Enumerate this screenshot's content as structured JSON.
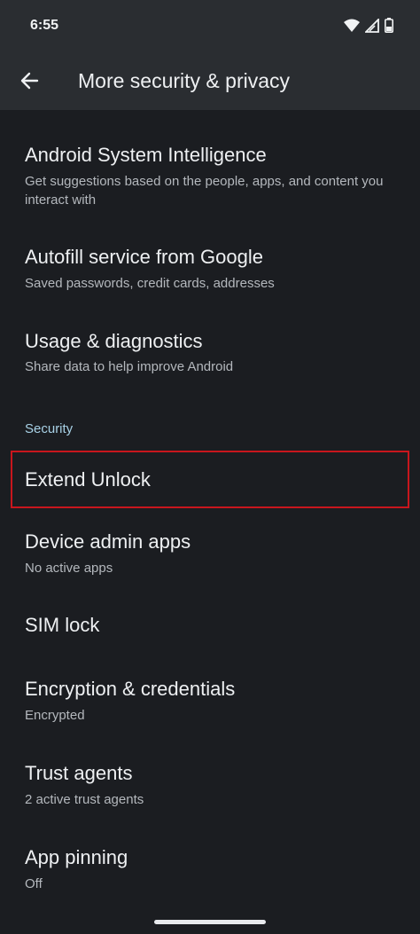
{
  "status_bar": {
    "time": "6:55",
    "icons": [
      "wifi-icon",
      "signal-icon",
      "battery-icon"
    ]
  },
  "app_bar": {
    "back_icon": "arrow-back-icon",
    "title": "More security & privacy"
  },
  "items": [
    {
      "title": "Android System Intelligence",
      "subtitle": "Get suggestions based on the people, apps, and content you interact with"
    },
    {
      "title": "Autofill service from Google",
      "subtitle": "Saved passwords, credit cards, addresses"
    },
    {
      "title": "Usage & diagnostics",
      "subtitle": "Share data to help improve Android"
    }
  ],
  "security_section": {
    "header": "Security",
    "items": [
      {
        "title": "Extend Unlock"
      },
      {
        "title": "Device admin apps",
        "subtitle": "No active apps"
      },
      {
        "title": "SIM lock"
      },
      {
        "title": "Encryption & credentials",
        "subtitle": "Encrypted"
      },
      {
        "title": "Trust agents",
        "subtitle": "2 active trust agents"
      },
      {
        "title": "App pinning",
        "subtitle": "Off"
      }
    ]
  },
  "colors": {
    "background": "#1b1d21",
    "app_bar": "#2a2d31",
    "section_header": "#a8d1e6",
    "highlight_border": "#c8161d"
  }
}
